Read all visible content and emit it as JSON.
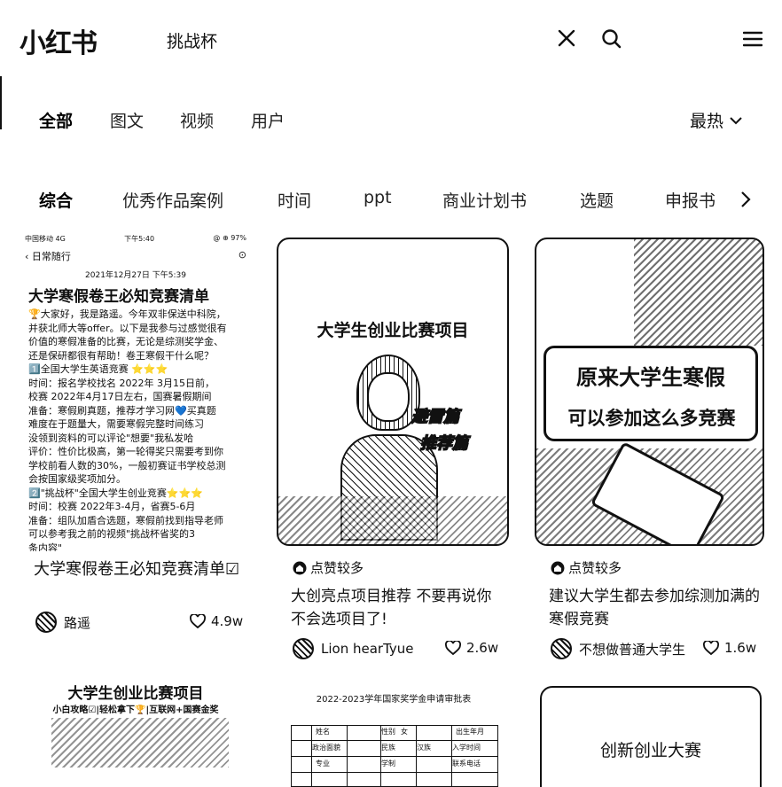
{
  "header": {
    "logo": "小红书",
    "search_query": "挑战杯"
  },
  "type_tabs": [
    "全部",
    "图文",
    "视频",
    "用户"
  ],
  "sort_label": "最热",
  "topics": [
    "综合",
    "优秀作品案例",
    "时间",
    "ppt",
    "商业计划书",
    "选题",
    "申报书"
  ],
  "cards": [
    {
      "cover": {
        "status_left": "中国移动 4G",
        "status_mid": "下午5:40",
        "status_right": "@ ⊕ 97%",
        "back_label": "日常随行",
        "date": "2021年12月27日 下午5:39",
        "title": "大学寒假卷王必知竞赛清单",
        "lines": [
          "🏆大家好，我是路遥。今年双非保送中科院，",
          "并获北师大等offer。以下是我参与过感觉很有",
          "价值的寒假准备的比赛，无论是综测奖学金、",
          "还是保研都很有帮助！卷王寒假干什么呢？",
          "1️⃣全国大学生英语竞赛 ⭐⭐⭐",
          "时间：报名学校找名 2022年 3月15日前，",
          "      校赛 2022年4月17日左右，国赛暑假期间",
          "准备：寒假刷真题，推荐才学习网💙买真题",
          "      难度在于题量大，需要寒假完整时间练习",
          "      没领到资料的可以评论\"想要\"我私发哈",
          "评价：性价比极高，第一轮得奖只需要考到你",
          "学校前看人数的30%，一般初赛证书学校总测",
          "会按国家级奖项加分。",
          "2️⃣\"挑战杯\"全国大学生创业竞赛⭐⭐⭐",
          "时间：校赛 2022年3-4月，省赛5-6月",
          "准备：组队加盾合选题，寒假前找到指导老师",
          "      可以参考我之前的视频\"挑战杯省奖的3",
          "      条内容\""
        ]
      },
      "title": "大学寒假卷王必知竞赛清单☑",
      "author": "路遥",
      "likes": "4.9w"
    },
    {
      "cover": {
        "poster_title": "大学生创业比赛项目",
        "sticker_1": "避雷篇",
        "sticker_2": "推荐篇"
      },
      "hot_label": "点赞较多",
      "title": "大创亮点项目推荐 不要再说你不会选项目了!",
      "author": "Lion hearTyue",
      "likes": "2.6w"
    },
    {
      "cover": {
        "poster_line_1": "原来大学生寒假",
        "poster_line_2": "可以参加这么多竞赛"
      },
      "hot_label": "点赞较多",
      "title": "建议大学生都去参加综测加满的寒假竞赛",
      "author": "不想做普通大学生",
      "likes": "1.6w"
    },
    {
      "cover": {
        "title": "大学生创业比赛项目",
        "subtitle": "小白攻略☑|轻松拿下🏆|互联网+国赛金奖"
      }
    },
    {
      "cover": {
        "title": "2022-2023学年国家奖学金申请审批表",
        "row_labels": [
          "姓名",
          "性别",
          "女",
          "出生年月",
          "政治面貌",
          "民族",
          "汉族",
          "入学时间",
          "专业",
          "学制",
          "联系电话"
        ]
      }
    },
    {
      "cover": {
        "title": "创新创业大赛"
      }
    }
  ],
  "colors": {
    "text": "#111111",
    "background": "#ffffff"
  }
}
